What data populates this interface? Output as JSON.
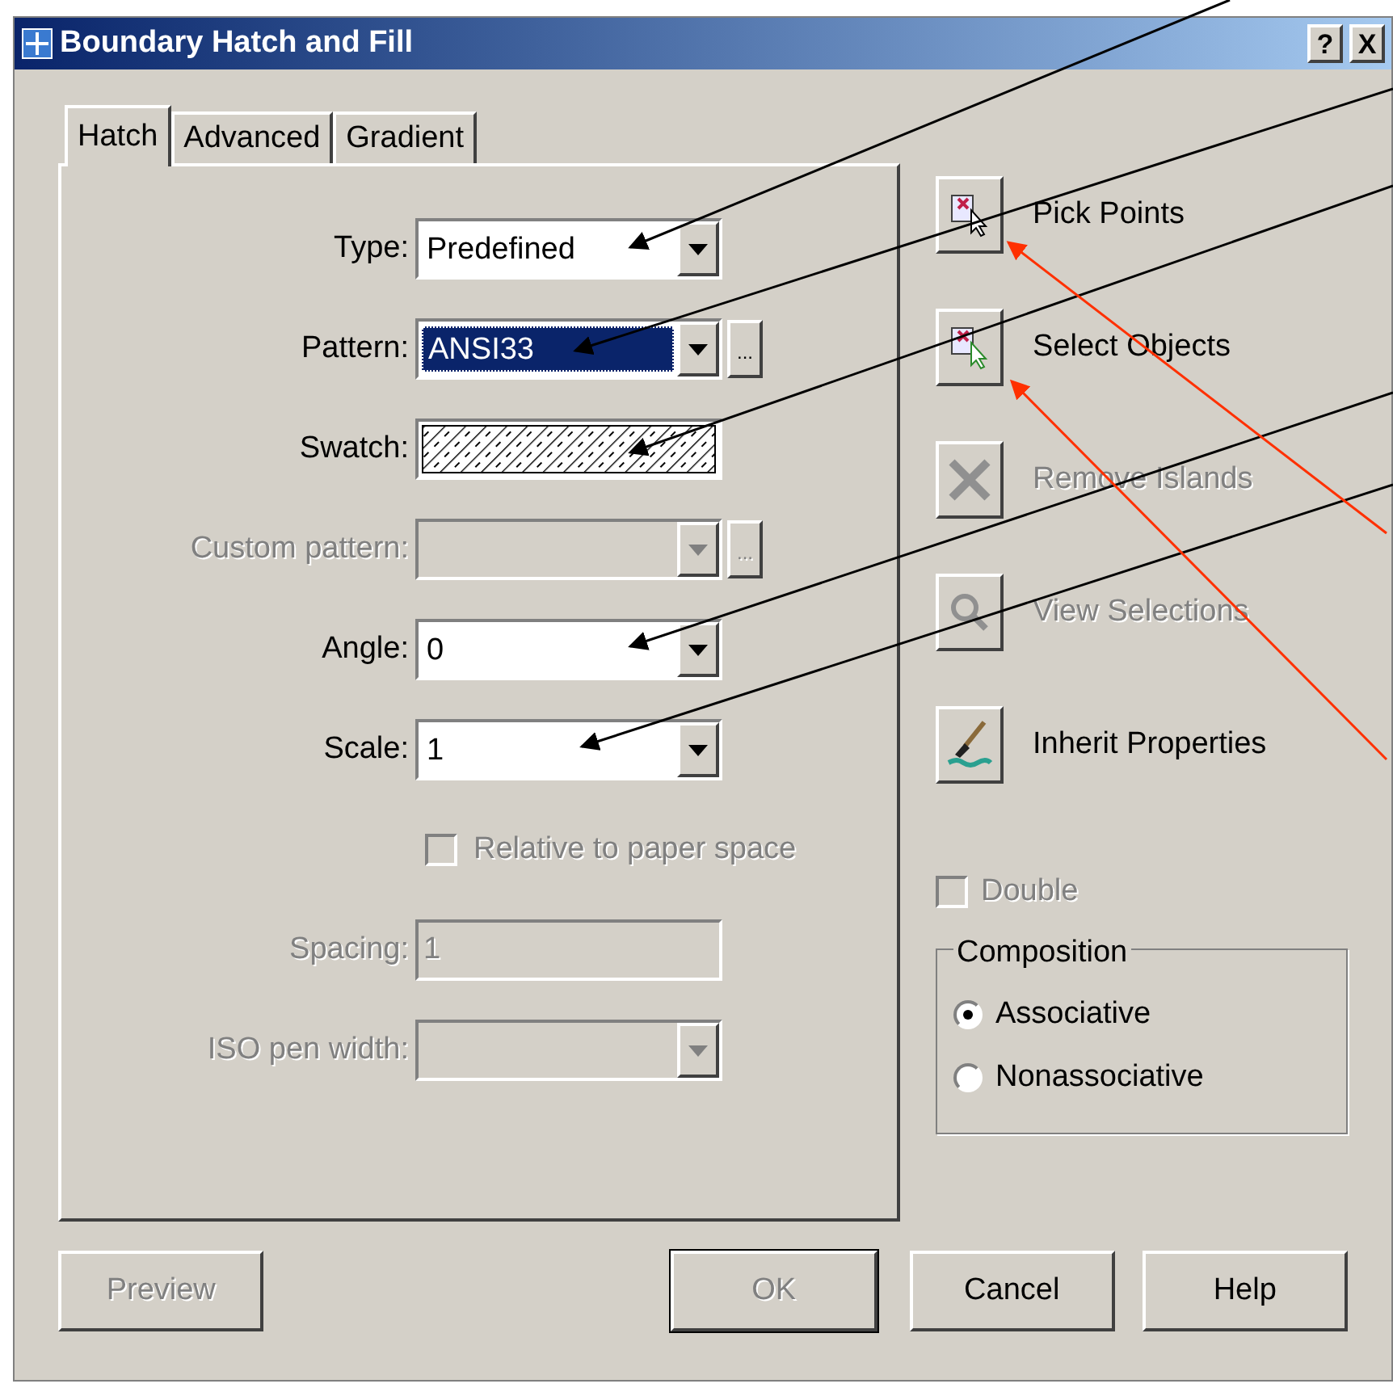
{
  "window": {
    "title": "Boundary Hatch and Fill",
    "title_buttons": [
      {
        "label": "?"
      },
      {
        "label": "X"
      }
    ]
  },
  "tabs": [
    {
      "label": "Hatch",
      "selected": true
    },
    {
      "label": "Advanced",
      "selected": false
    },
    {
      "label": "Gradient",
      "selected": false
    }
  ],
  "fields": [
    {
      "kind": "dropdown",
      "label": "Type:",
      "value": "Predefined",
      "disabled": false
    },
    {
      "kind": "dropdown",
      "label": "Pattern:",
      "value": "ANSI33",
      "disabled": false,
      "highlighted": true,
      "browse_button": "..."
    },
    {
      "kind": "swatch",
      "label": "Swatch:"
    },
    {
      "kind": "dropdown",
      "label": "Custom pattern:",
      "disabled": true,
      "browse_button": "..."
    },
    {
      "kind": "dropdown",
      "label": "Angle:",
      "value": "0",
      "disabled": false
    },
    {
      "kind": "dropdown",
      "label": "Scale:",
      "value": "1",
      "disabled": false
    },
    {
      "kind": "checkbox",
      "label": "Relative to paper space",
      "checked": false,
      "disabled": true
    },
    {
      "kind": "text",
      "label": "Spacing:",
      "value": "1",
      "disabled": true
    },
    {
      "kind": "dropdown",
      "label": "ISO pen width:",
      "disabled": true
    }
  ],
  "actions": [
    {
      "kind": "pick",
      "label": "Pick Points",
      "disabled": false
    },
    {
      "kind": "select",
      "label": "Select Objects",
      "disabled": false
    },
    {
      "kind": "remove",
      "label": "Remove Islands",
      "disabled": true
    },
    {
      "kind": "view",
      "label": "View Selections",
      "disabled": true
    },
    {
      "kind": "inherit",
      "label": "Inherit Properties",
      "disabled": false
    }
  ],
  "double": {
    "label": "Double",
    "checked": false,
    "disabled": true
  },
  "composition": {
    "title": "Composition",
    "options": [
      {
        "label": "Associative",
        "selected": true
      },
      {
        "label": "Nonassociative",
        "selected": false
      }
    ]
  },
  "buttons": [
    {
      "label": "Preview",
      "disabled": true,
      "default": false
    },
    {
      "label": "OK",
      "disabled": true,
      "default": true
    },
    {
      "label": "Cancel",
      "disabled": false,
      "default": false
    },
    {
      "label": "Help",
      "disabled": false,
      "default": false
    }
  ]
}
